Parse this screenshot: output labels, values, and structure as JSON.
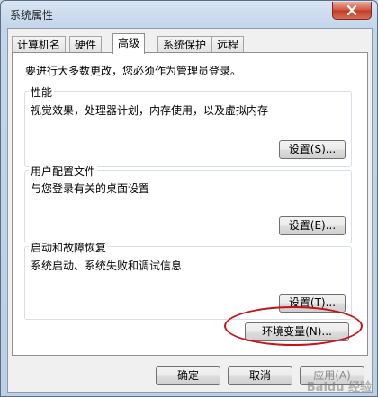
{
  "window": {
    "title": "系统属性"
  },
  "tabs": [
    {
      "label": "计算机名"
    },
    {
      "label": "硬件"
    },
    {
      "label": "高级",
      "active": true
    },
    {
      "label": "系统保护"
    },
    {
      "label": "远程"
    }
  ],
  "panel": {
    "notice": "要进行大多数更改，您必须作为管理员登录。",
    "performance": {
      "title": "性能",
      "desc": "视觉效果，处理器计划，内存使用，以及虚拟内存",
      "button": "设置(S)..."
    },
    "user_profiles": {
      "title": "用户配置文件",
      "desc": "与您登录有关的桌面设置",
      "button": "设置(E)..."
    },
    "startup_recovery": {
      "title": "启动和故障恢复",
      "desc": "系统启动、系统失败和调试信息",
      "button": "设置(T)..."
    },
    "env_button": "环境变量(N)..."
  },
  "footer": {
    "ok": "确定",
    "cancel": "取消",
    "apply": "应用(A)"
  },
  "watermark": "Baidu 经验",
  "colors": {
    "highlight_ring": "#c4141a",
    "title_bar": "#c3d5ea",
    "close_button": "#c23a22"
  }
}
